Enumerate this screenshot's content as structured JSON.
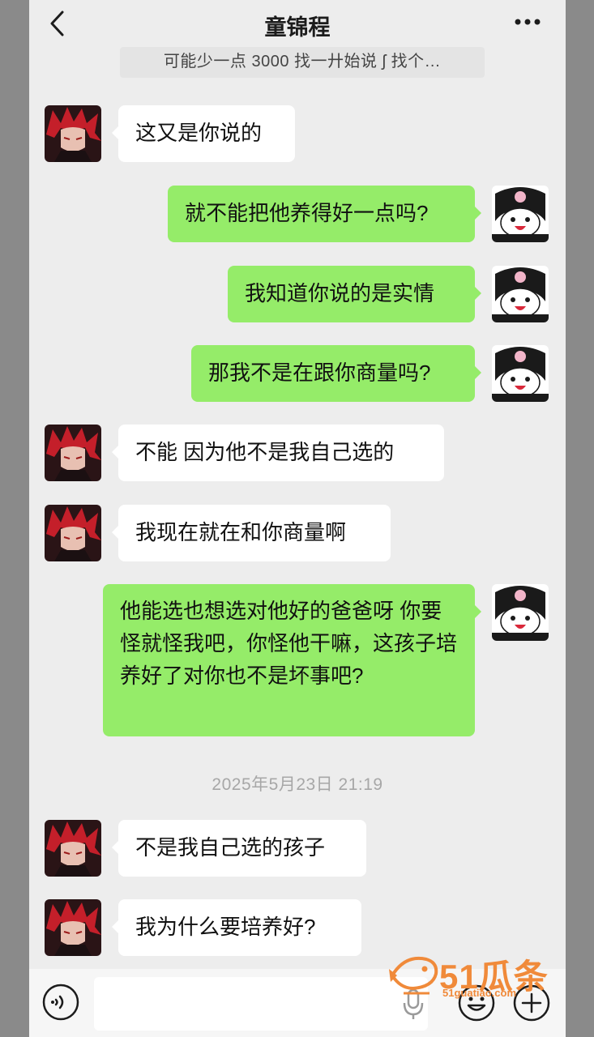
{
  "header": {
    "title": "童锦程",
    "pinned": "可能少一点 3000 找一廾始说 ʃ 找个…"
  },
  "messages": [
    {
      "side": "in",
      "text": "这又是你说的"
    },
    {
      "side": "out",
      "text": "就不能把他养得好一点吗?"
    },
    {
      "side": "out",
      "text": "我知道你说的是实情"
    },
    {
      "side": "out",
      "text": "那我不是在跟你商量吗?"
    },
    {
      "side": "in",
      "text": "不能 因为他不是我自己选的"
    },
    {
      "side": "in",
      "text": "我现在就在和你商量啊"
    },
    {
      "side": "out",
      "text": "他能选也想选对他好的爸爸呀 你要怪就怪我吧，你怪他干嘛，这孩子培养好了对你也不是坏事吧?"
    },
    {
      "side": "in",
      "text": "不是我自己选的孩子"
    },
    {
      "side": "in",
      "text": "我为什么要培养好?"
    }
  ],
  "timestamp": "2025年5月23日 21:19",
  "input": {
    "value": "",
    "placeholder": ""
  },
  "watermark": {
    "brand": "51瓜条",
    "url": "51guatiao.com"
  },
  "colors": {
    "sent_bubble": "#95ec69",
    "received_bubble": "#ffffff",
    "background": "#ededed"
  },
  "icons": [
    "back-icon",
    "more-icon",
    "voice-icon",
    "mic-icon",
    "emoji-icon",
    "plus-icon"
  ]
}
